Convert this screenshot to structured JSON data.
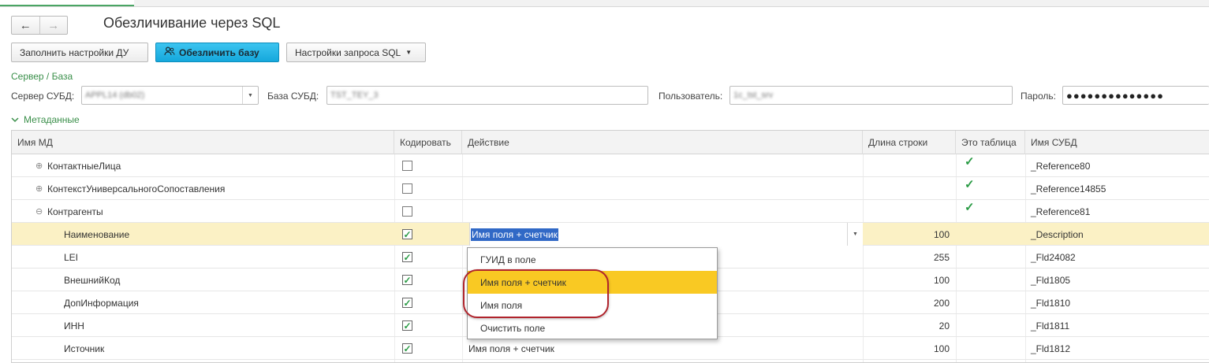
{
  "window": {
    "title": "Обезличивание через SQL"
  },
  "nav": {
    "back_icon": "←",
    "forward_icon": "→"
  },
  "toolbar": {
    "fill_settings_label": "Заполнить настройки ДУ",
    "anonymize_label": "Обезличить базу",
    "anonymize_icon": "user-group-icon",
    "sql_settings_label": "Настройки запроса SQL",
    "accent_color": "#1eb0e2"
  },
  "server_section": {
    "group_title": "Сервер / База",
    "server_label": "Сервер СУБД:",
    "server_value": "APPL14 (db02)",
    "db_label": "База СУБД:",
    "db_value": "TST_TEY_3",
    "user_label": "Пользователь:",
    "user_value": "1c_tst_srv",
    "password_label": "Пароль:",
    "password_value": "●●●●●●●●●●●●●●"
  },
  "metadata": {
    "group_title": "Метаданные",
    "columns": [
      "Имя МД",
      "Кодировать",
      "Действие",
      "Длина строки",
      "Это таблица",
      "Имя СУБД"
    ],
    "rows": [
      {
        "name": "КонтактныеЛица",
        "toggle": "⊕",
        "encode": false,
        "action": "",
        "length": "",
        "is_table": true,
        "dbms_name": "_Reference80"
      },
      {
        "name": "КонтекстУниверсальногоСопоставления",
        "toggle": "⊕",
        "encode": false,
        "action": "",
        "length": "",
        "is_table": true,
        "dbms_name": "_Reference14855"
      },
      {
        "name": "Контрагенты",
        "toggle": "⊖",
        "encode": false,
        "action": "",
        "length": "",
        "is_table": true,
        "dbms_name": "_Reference81"
      },
      {
        "name": "Наименование",
        "toggle": "",
        "encode": true,
        "action": "Имя поля + счетчик",
        "length": "100",
        "is_table": false,
        "dbms_name": "_Description"
      },
      {
        "name": "LEI",
        "toggle": "",
        "encode": true,
        "action": "",
        "length": "255",
        "is_table": false,
        "dbms_name": "_Fld24082"
      },
      {
        "name": "ВнешнийКод",
        "toggle": "",
        "encode": true,
        "action": "",
        "length": "100",
        "is_table": false,
        "dbms_name": "_Fld1805"
      },
      {
        "name": "ДопИнформация",
        "toggle": "",
        "encode": true,
        "action": "",
        "length": "200",
        "is_table": false,
        "dbms_name": "_Fld1810"
      },
      {
        "name": "ИНН",
        "toggle": "",
        "encode": true,
        "action": "",
        "length": "20",
        "is_table": false,
        "dbms_name": "_Fld1811"
      },
      {
        "name": "Источник",
        "toggle": "",
        "encode": true,
        "action": "Имя поля + счетчик",
        "length": "100",
        "is_table": false,
        "dbms_name": "_Fld1812"
      }
    ]
  },
  "action_dropdown": {
    "options": [
      "ГУИД в поле",
      "Имя поля + счетчик",
      "Имя поля",
      "Очистить поле"
    ],
    "highlighted_index": 1,
    "highlight_color": "#f9c923"
  },
  "colors": {
    "group_title": "#3a8f4a",
    "selected_row": "#fbf1c5",
    "check": "#2a9b45",
    "annotation": "#b0242c"
  }
}
